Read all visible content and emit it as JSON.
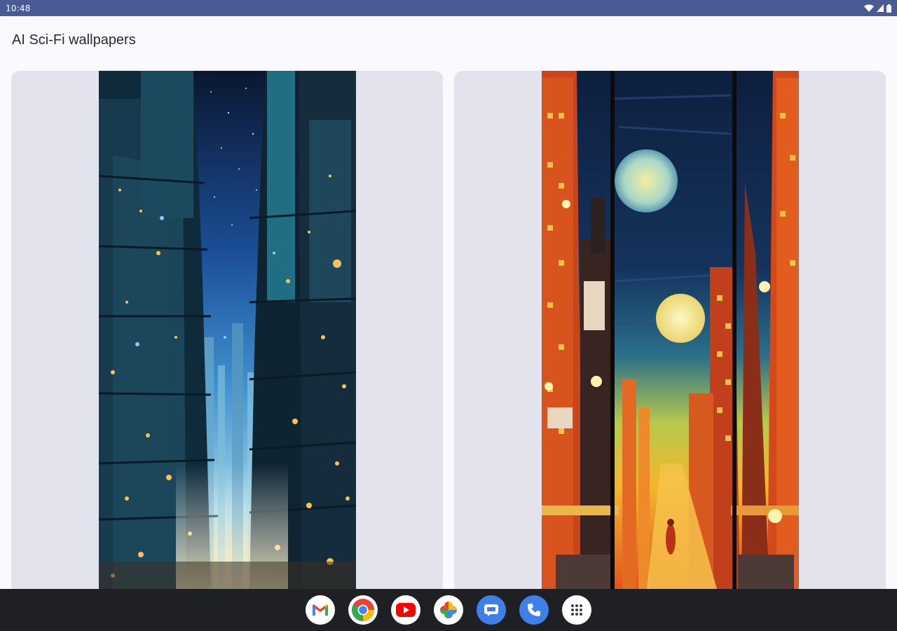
{
  "status_bar": {
    "time": "10:48",
    "icons": [
      "wifi-icon",
      "signal-icon",
      "battery-icon"
    ]
  },
  "header": {
    "title": "AI Sci-Fi wallpapers"
  },
  "wallpapers": [
    {
      "name": "blue-neon-city-wallpaper",
      "palette": [
        "#0d1b2e",
        "#1e5aa8",
        "#4fa3d9",
        "#f4b34a"
      ]
    },
    {
      "name": "orange-moon-city-wallpaper",
      "palette": [
        "#0f2346",
        "#d8461a",
        "#f29a2b",
        "#f5e28a"
      ]
    }
  ],
  "taskbar": {
    "apps": [
      {
        "name": "gmail-icon",
        "bg": "#ffffff"
      },
      {
        "name": "chrome-icon",
        "bg": "#ffffff"
      },
      {
        "name": "youtube-icon",
        "bg": "#ffffff"
      },
      {
        "name": "photos-icon",
        "bg": "#ffffff"
      },
      {
        "name": "messages-icon",
        "bg": "#3f7fe8"
      },
      {
        "name": "phone-icon",
        "bg": "#3f7fe8"
      },
      {
        "name": "app-drawer-icon",
        "bg": "#ffffff"
      }
    ]
  },
  "colors": {
    "status_bar": "#4a5a94",
    "card_bg": "#e2e3ec",
    "taskbar_bg": "#1f2024"
  }
}
